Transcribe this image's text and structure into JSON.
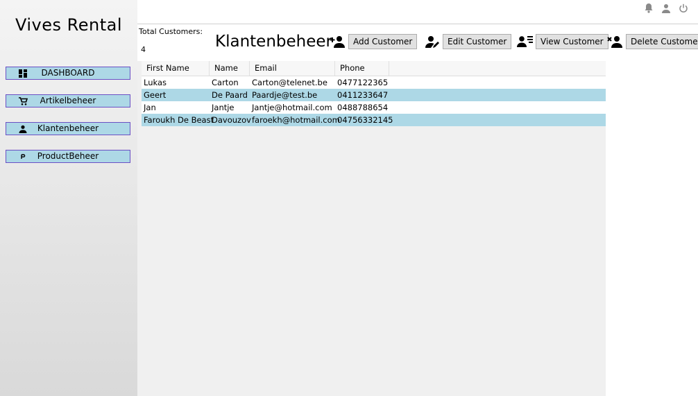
{
  "app": {
    "title": "Vives Rental"
  },
  "sidebar": {
    "items": [
      {
        "label": "DASHBOARD",
        "icon": "dashboard-icon"
      },
      {
        "label": "Artikelbeheer",
        "icon": "cart-icon"
      },
      {
        "label": "Klantenbeheer",
        "icon": "person-icon"
      },
      {
        "label": "ProductBeheer",
        "icon": "letter-p-icon"
      }
    ]
  },
  "topbar": {
    "icons": [
      "bell-icon",
      "user-icon",
      "power-icon"
    ]
  },
  "summary": {
    "total_label": "Total Customers:",
    "total_count": "4"
  },
  "page": {
    "title": "Klantenbeheer"
  },
  "actions": {
    "add": "Add Customer",
    "edit": "Edit Customer",
    "view": "View Customer",
    "delete": "Delete Customer"
  },
  "table": {
    "columns": [
      "First Name",
      "Name",
      "Email",
      "Phone"
    ],
    "rows": [
      [
        "Lukas",
        "Carton",
        "Carton@telenet.be",
        "0477122365"
      ],
      [
        "Geert",
        "De Paard",
        "Paardje@test.be",
        "0411233647"
      ],
      [
        "Jan",
        "Jantje",
        "Jantje@hotmail.com",
        "0488788654"
      ],
      [
        "Faroukh De Beast",
        "Davouzov",
        "faroekh@hotmail.com",
        "04756332145"
      ]
    ]
  },
  "colors": {
    "nav_fill": "#add8e6",
    "nav_border": "#6a4fc4",
    "row_alt": "#add8e6",
    "button_fill": "#e1e1e1"
  }
}
